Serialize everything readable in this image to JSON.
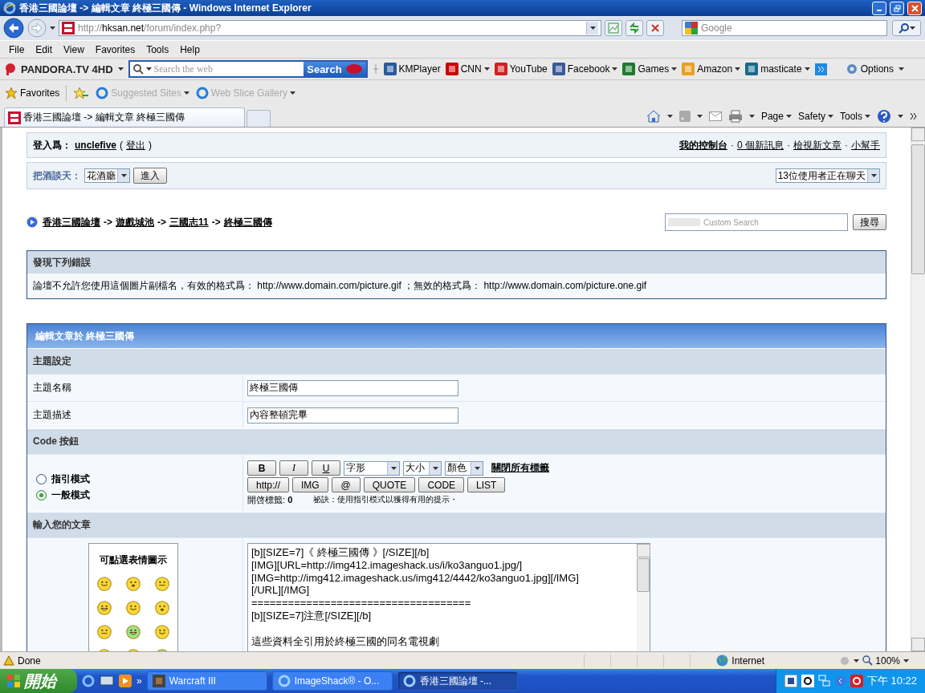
{
  "window": {
    "title": "香港三國論壇 -> 編輯文章 終極三國傳 - Windows Internet Explorer"
  },
  "address": {
    "scheme": "http://",
    "host": "hksan.net",
    "path": "/forum/index.php?"
  },
  "web_search": {
    "placeholder": "Google"
  },
  "menu": [
    "File",
    "Edit",
    "View",
    "Favorites",
    "Tools",
    "Help"
  ],
  "toolbar": {
    "brand": "PANDORA.TV 4HD",
    "search_placeholder": "Search the web",
    "search_button": "Search",
    "options": "Options",
    "links": [
      {
        "label": "KMPlayer",
        "dropdown": false,
        "color": "#2a5a9a"
      },
      {
        "label": "CNN",
        "dropdown": true,
        "color": "#cc0000"
      },
      {
        "label": "YouTube",
        "dropdown": false,
        "color": "#d02020"
      },
      {
        "label": "Facebook",
        "dropdown": true,
        "color": "#3b5998"
      },
      {
        "label": "Games",
        "dropdown": true,
        "color": "#1f7a2e"
      },
      {
        "label": "Amazon",
        "dropdown": true,
        "color": "#e8a020"
      },
      {
        "label": "masticate",
        "dropdown": true,
        "color": "#1a6a8a"
      }
    ]
  },
  "favorites": {
    "label": "Favorites",
    "items": [
      {
        "label": "Suggested Sites",
        "disabled": true
      },
      {
        "label": "Web Slice Gallery",
        "disabled": true
      }
    ]
  },
  "tabs": [
    {
      "label": "香港三國論壇 -> 編輯文章 終極三國傳",
      "selected": true
    }
  ],
  "command_bar": [
    "Page",
    "Safety",
    "Tools"
  ],
  "page": {
    "login": {
      "label": "登入爲：",
      "user": "unclefive",
      "logout_open": "(",
      "logout": "登出",
      "logout_close": ")"
    },
    "user_links": [
      {
        "label": "我的控制台",
        "bold": true
      },
      {
        "label": "0 個新訊息",
        "bold": false
      },
      {
        "label": "檢視新文章",
        "bold": false
      },
      {
        "label": "小幫手",
        "bold": false
      }
    ],
    "chat": {
      "label": "把酒談天：",
      "room": "花酒廳",
      "enter": "進入",
      "users": "13位使用者正在聊天"
    },
    "user_links_separator": "·",
    "breadcrumb": [
      "香港三國論壇",
      "遊戲城池",
      "三國志11",
      "終極三國傳"
    ],
    "breadcrumb_separator": "->",
    "site_search": {
      "placeholder": "Custom Search",
      "button": "搜尋"
    },
    "error": {
      "title": "發現下列錯誤",
      "message": "論壇不允許您使用這個圖片副檔名，有效的格式爲： http://www.domain.com/picture.gif ；無效的格式爲： http://www.domain.com/picture.one.gif"
    },
    "form": {
      "title": "編輯文章於 終極三國傳",
      "topic_section": "主題設定",
      "fields": [
        {
          "label": "主題名稱",
          "value": "終極三國傳"
        },
        {
          "label": "主題描述",
          "value": "內容整頓完畢"
        }
      ],
      "code_section": "Code 按鈕",
      "modes": [
        {
          "label": "指引模式",
          "selected": false
        },
        {
          "label": "一般模式",
          "selected": true
        }
      ],
      "style_buttons": [
        {
          "label": "B",
          "kind": "bold"
        },
        {
          "label": "I",
          "kind": "italic"
        },
        {
          "label": "U",
          "kind": "underline"
        }
      ],
      "selects": [
        "字形",
        "大小",
        "顏色"
      ],
      "close_tags": "關閉所有標籤",
      "tag_buttons": [
        "http://",
        "IMG",
        "@",
        "QUOTE",
        "CODE",
        "LIST"
      ],
      "open_tags_label": "開啓標籤:",
      "open_tags": "0",
      "tip": "祕訣：使用指引模式以獲得有用的提示・",
      "message_section": "輸入您的文章",
      "emoticons_title": "可點選表情圖示",
      "message": [
        [
          "[b][SIZE=7]《 終極三國傳 》[/SIZE][/b]",
          "[IMG][URL=http://img412.imageshack.us/i/ko3anguo1.jpg/]",
          "[IMG=http://img412.imageshack.us/img412/4442/ko3anguo1.jpg][/IMG]",
          "[/URL][/IMG]",
          "====================================",
          "[b][SIZE=7]注意[/SIZE][/b]"
        ],
        [
          "這些資料全引用於終極三國的同名電視劇"
        ]
      ]
    }
  },
  "status": {
    "text": "Done",
    "zone": "Internet",
    "zoom": "100%"
  },
  "taskbar": {
    "start": "開始",
    "more": "»",
    "tasks": [
      {
        "label": "Warcraft III",
        "selected": false
      },
      {
        "label": "ImageShack® - O...",
        "selected": false
      },
      {
        "label": "香港三國論壇 -...",
        "selected": true
      }
    ],
    "clock": "下午 10:22"
  }
}
